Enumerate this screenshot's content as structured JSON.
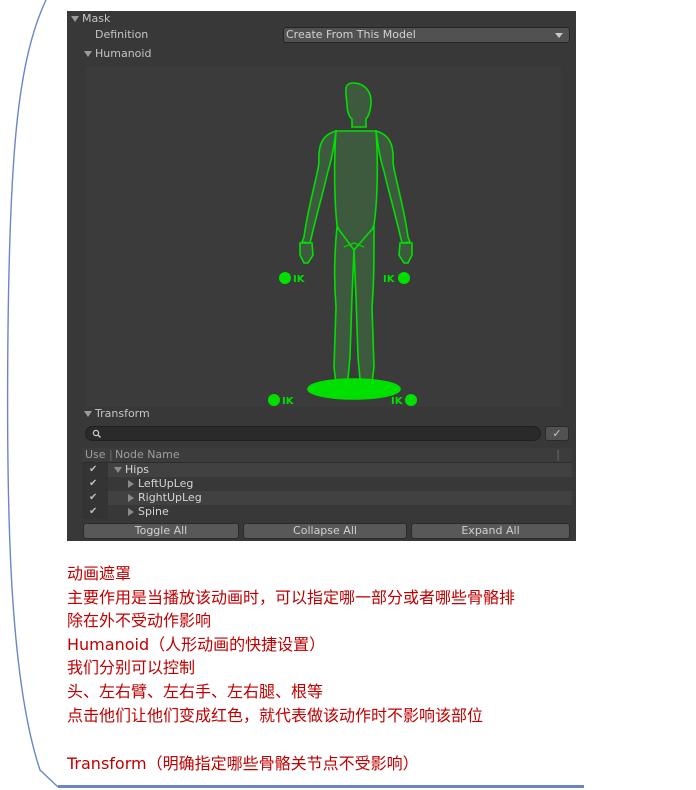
{
  "inspector": {
    "mask_label": "Mask",
    "definition_label": "Definition",
    "definition_value": "Create From This Model",
    "humanoid_label": "Humanoid",
    "ik_label": "IK",
    "transform_label": "Transform",
    "search_placeholder": "",
    "tree": {
      "col_use": "Use",
      "col_sep": "|",
      "col_node": "Node Name",
      "rows": [
        {
          "name": "Hips"
        },
        {
          "name": "LeftUpLeg"
        },
        {
          "name": "RightUpLeg"
        },
        {
          "name": "Spine"
        }
      ]
    },
    "buttons": {
      "toggle_all": "Toggle All",
      "collapse_all": "Collapse All",
      "expand_all": "Expand All"
    },
    "colors": {
      "panel_bg": "#383838",
      "avatar_green": "#00e000",
      "note_red": "#c00000"
    }
  },
  "notes": {
    "line1": "动画遮罩",
    "line2": "主要作用是当播放该动画时，可以指定哪一部分或者哪些骨骼排",
    "line3": "除在外不受动作影响",
    "line4": "Humanoid（人形动画的快捷设置）",
    "line5": "我们分别可以控制",
    "line6": "头、左右臂、左右手、左右腿、根等",
    "line7": "点击他们让他们变成红色，就代表做该动作时不影响该部位",
    "line8": "Transform（明确指定哪些骨骼关节点不受影响）"
  }
}
